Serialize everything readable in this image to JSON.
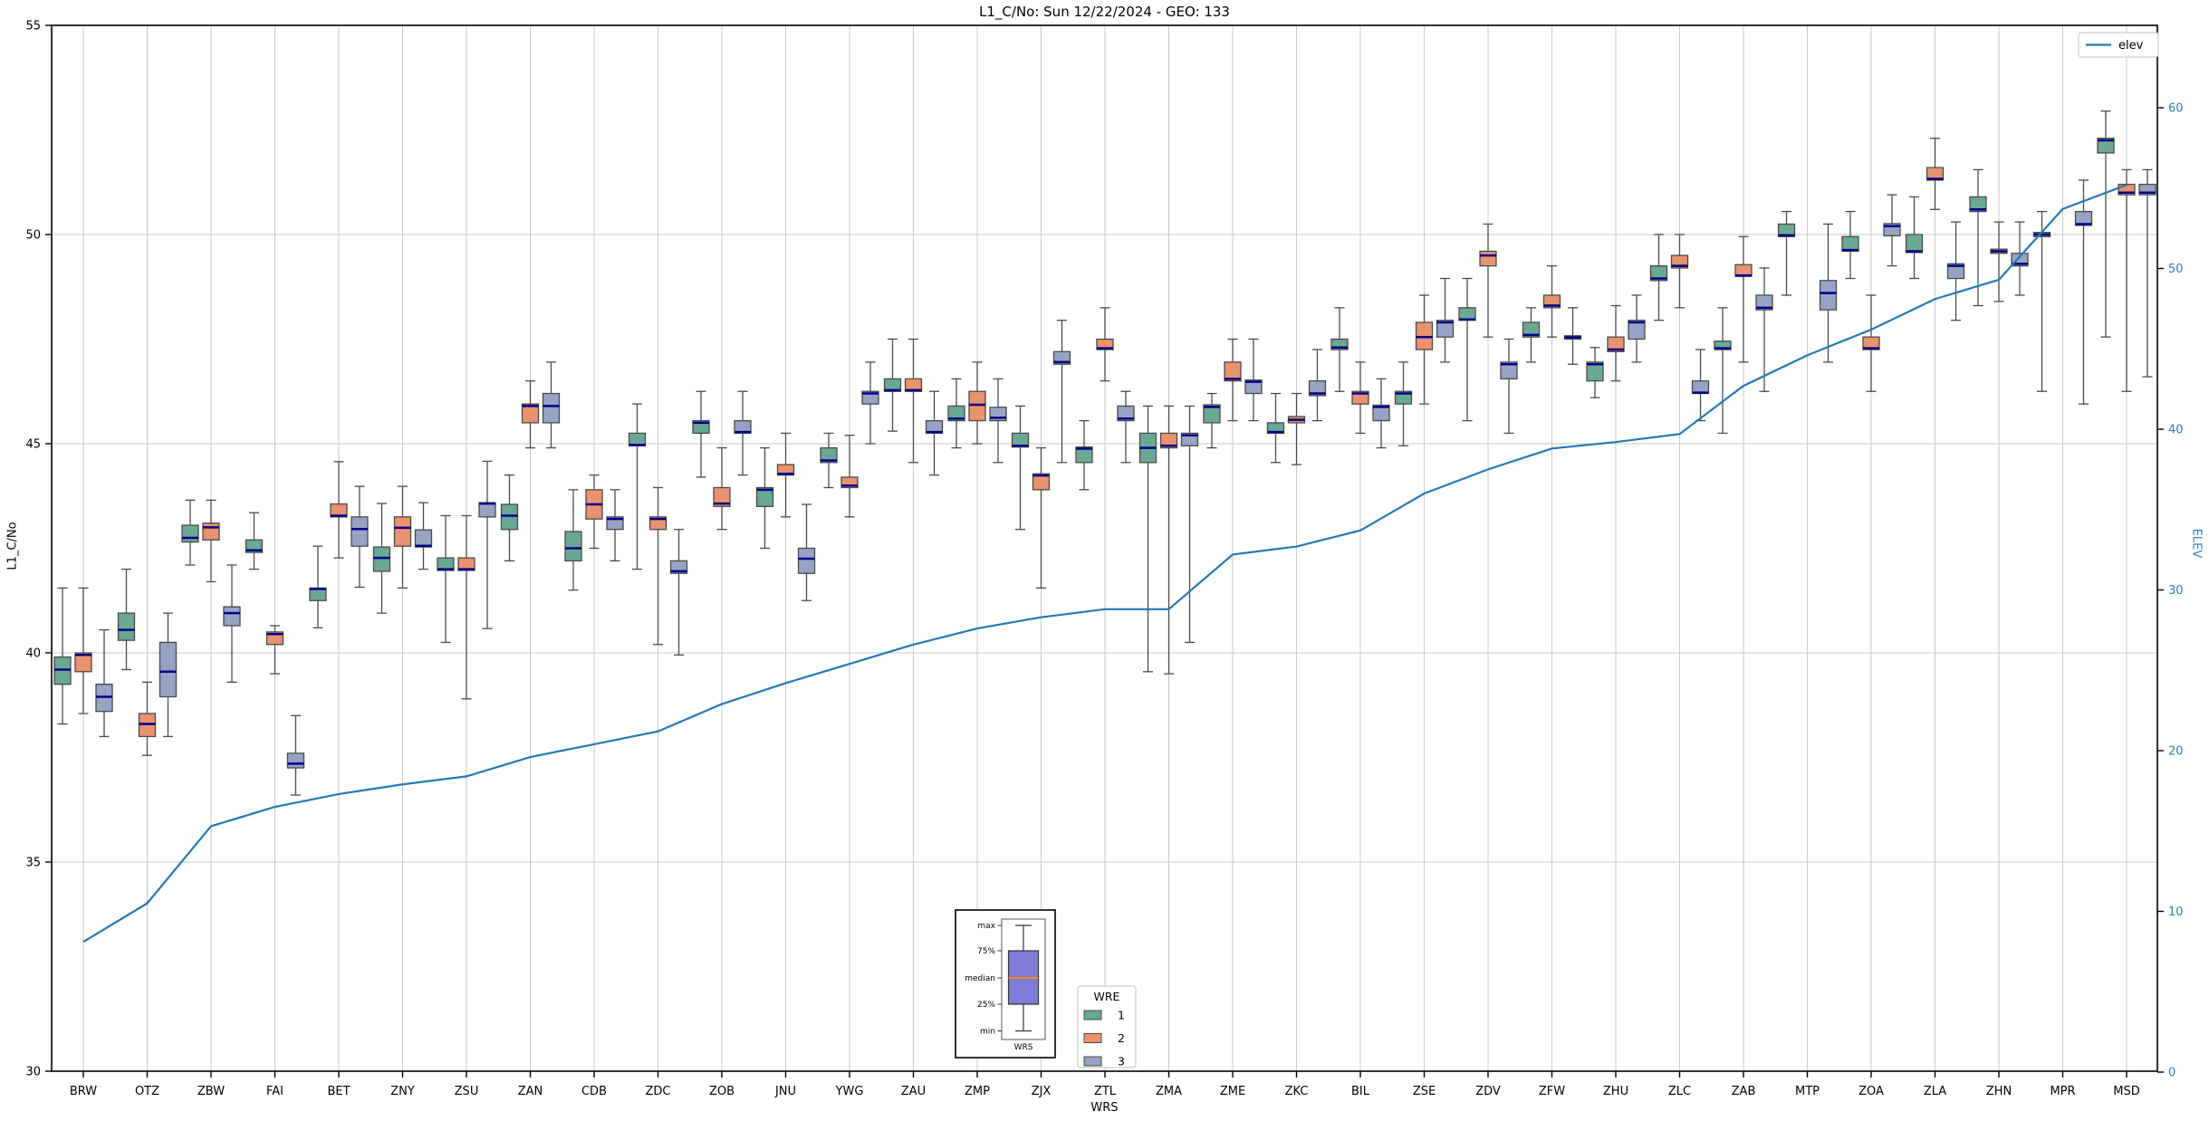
{
  "title": "L1_C/No: Sun 12/22/2024 - GEO: 133",
  "axes": {
    "xlabel": "WRS",
    "ylabel_left": "L1_C/No",
    "ylabel_right": "ELEV",
    "yticks_left": [
      55,
      50,
      45,
      40,
      35,
      30
    ],
    "yticks_right": [
      60,
      50,
      40,
      30,
      20,
      10,
      0
    ]
  },
  "legend_line": {
    "label": "elev"
  },
  "legend_wre": {
    "title": "WRE",
    "entries": [
      {
        "label": "1",
        "color": "#6aa893"
      },
      {
        "label": "2",
        "color": "#e9926f"
      },
      {
        "label": "3",
        "color": "#97a3c4"
      }
    ]
  },
  "inset": {
    "labels": [
      "max",
      "75%",
      "median",
      "25%",
      "min"
    ],
    "xlabel": "WRS"
  },
  "chart_data": {
    "type": "boxplot+line",
    "title": "L1_C/No: Sun 12/22/2024 - GEO: 133",
    "xlabel": "WRS",
    "ylabel_left": "L1_C/No",
    "ylabel_right": "ELEV",
    "ylim_left": [
      30,
      55
    ],
    "yticks_right": [
      0,
      10,
      20,
      30,
      40,
      50,
      60
    ],
    "grid": true,
    "legend_position_line": "top-right",
    "legend_position_wre": "bottom-center",
    "categories": [
      "BRW",
      "OTZ",
      "ZBW",
      "FAI",
      "BET",
      "ZNY",
      "ZSU",
      "ZAN",
      "CDB",
      "ZDC",
      "ZOB",
      "JNU",
      "YWG",
      "ZAU",
      "ZMP",
      "ZJX",
      "ZTL",
      "ZMA",
      "ZME",
      "ZKC",
      "BIL",
      "ZSE",
      "ZDV",
      "ZFW",
      "ZHU",
      "ZLC",
      "ZAB",
      "MTP",
      "ZOA",
      "ZLA",
      "ZHN",
      "MPR",
      "MSD"
    ],
    "box_format": [
      "whisker_low",
      "q1",
      "median",
      "q3",
      "whisker_high"
    ],
    "series": [
      {
        "name": "1",
        "color": "#6aa893",
        "boxes": [
          [
            38.3,
            39.25,
            39.6,
            39.9,
            41.55
          ],
          [
            39.6,
            40.3,
            40.55,
            40.95,
            42.0
          ],
          [
            42.1,
            42.65,
            42.75,
            43.05,
            43.65
          ],
          [
            42.0,
            42.4,
            42.45,
            42.7,
            43.35
          ],
          [
            40.6,
            41.25,
            41.53,
            41.55,
            42.55
          ],
          [
            40.95,
            41.95,
            42.27,
            42.53,
            43.57
          ],
          [
            40.25,
            41.97,
            42.0,
            42.27,
            43.28
          ],
          [
            42.2,
            42.95,
            43.28,
            43.55,
            44.25
          ],
          [
            41.5,
            42.2,
            42.5,
            42.9,
            43.9
          ],
          [
            42.0,
            44.95,
            44.97,
            45.25,
            45.95
          ],
          [
            44.2,
            45.25,
            45.5,
            45.55,
            46.25
          ],
          [
            42.5,
            43.5,
            43.9,
            43.95,
            44.9
          ],
          [
            43.95,
            44.55,
            44.6,
            44.9,
            45.25
          ],
          [
            45.3,
            46.25,
            46.28,
            46.55,
            47.5
          ],
          [
            44.9,
            45.55,
            45.6,
            45.9,
            46.55
          ],
          [
            42.95,
            44.92,
            44.95,
            45.25,
            45.9
          ],
          [
            43.9,
            44.55,
            44.88,
            44.92,
            45.55
          ],
          [
            39.55,
            44.55,
            44.9,
            45.25,
            45.9
          ],
          [
            44.9,
            45.5,
            45.88,
            45.93,
            46.2
          ],
          [
            44.55,
            45.25,
            45.28,
            45.5,
            46.2
          ],
          [
            46.25,
            47.25,
            47.3,
            47.5,
            48.25
          ],
          [
            44.95,
            45.95,
            46.2,
            46.25,
            46.95
          ],
          [
            45.55,
            47.95,
            47.97,
            48.25,
            48.95
          ],
          [
            46.95,
            47.55,
            47.6,
            47.9,
            48.25
          ],
          [
            46.1,
            46.5,
            46.9,
            46.95,
            47.3
          ],
          [
            47.95,
            48.9,
            48.95,
            49.25,
            50.0
          ],
          [
            45.25,
            47.25,
            47.28,
            47.45,
            48.25
          ],
          [
            48.55,
            49.95,
            49.98,
            50.25,
            50.55
          ],
          [
            48.95,
            49.6,
            49.63,
            49.95,
            50.55
          ],
          [
            48.95,
            49.57,
            49.6,
            50.0,
            50.9
          ],
          [
            48.3,
            50.55,
            50.6,
            50.9,
            51.55
          ],
          [
            46.25,
            49.95,
            50.0,
            50.05,
            50.55
          ],
          [
            47.55,
            51.95,
            52.25,
            52.3,
            52.95
          ]
        ]
      },
      {
        "name": "2",
        "color": "#e9926f",
        "boxes": [
          [
            38.55,
            39.55,
            39.95,
            40.0,
            41.55
          ],
          [
            37.55,
            38.0,
            38.3,
            38.55,
            39.3
          ],
          [
            41.7,
            42.7,
            43.0,
            43.1,
            43.65
          ],
          [
            39.5,
            40.2,
            40.45,
            40.5,
            40.65
          ],
          [
            42.27,
            43.25,
            43.28,
            43.56,
            44.57
          ],
          [
            41.55,
            42.55,
            42.99,
            43.25,
            43.98
          ],
          [
            38.9,
            41.97,
            42.0,
            42.27,
            43.28
          ],
          [
            44.9,
            45.5,
            45.9,
            45.95,
            46.5
          ],
          [
            42.5,
            43.2,
            43.55,
            43.9,
            44.25
          ],
          [
            40.2,
            42.95,
            43.2,
            43.25,
            43.95
          ],
          [
            42.95,
            43.5,
            43.57,
            43.95,
            44.9
          ],
          [
            43.25,
            44.25,
            44.28,
            44.5,
            45.25
          ],
          [
            43.25,
            43.95,
            44.0,
            44.2,
            45.2
          ],
          [
            44.55,
            46.25,
            46.28,
            46.55,
            47.5
          ],
          [
            45.0,
            45.55,
            45.93,
            46.25,
            46.95
          ],
          [
            41.55,
            43.9,
            44.24,
            44.28,
            44.9
          ],
          [
            46.5,
            47.25,
            47.28,
            47.5,
            48.25
          ],
          [
            39.5,
            44.9,
            44.95,
            45.25,
            45.9
          ],
          [
            45.55,
            46.5,
            46.55,
            46.95,
            47.5
          ],
          [
            44.5,
            45.5,
            45.57,
            45.65,
            46.2
          ],
          [
            45.25,
            45.95,
            46.2,
            46.25,
            46.95
          ],
          [
            45.95,
            47.25,
            47.55,
            47.9,
            48.55
          ],
          [
            47.55,
            49.25,
            49.5,
            49.6,
            50.25
          ],
          [
            47.55,
            48.25,
            48.3,
            48.55,
            49.25
          ],
          [
            46.5,
            47.2,
            47.25,
            47.55,
            48.3
          ],
          [
            48.25,
            49.2,
            49.25,
            49.5,
            50.0
          ],
          [
            46.95,
            49.0,
            49.02,
            49.28,
            49.95
          ],
          null,
          [
            46.25,
            47.25,
            47.28,
            47.55,
            48.55
          ],
          [
            50.6,
            51.3,
            51.33,
            51.6,
            52.3
          ],
          [
            48.4,
            49.55,
            49.6,
            49.65,
            50.3
          ],
          null,
          [
            46.25,
            50.95,
            51.0,
            51.2,
            51.55
          ]
        ]
      },
      {
        "name": "3",
        "color": "#97a3c4",
        "boxes": [
          [
            38.0,
            38.6,
            38.95,
            39.25,
            40.55
          ],
          [
            38.0,
            38.95,
            39.55,
            40.25,
            40.95
          ],
          [
            39.3,
            40.65,
            40.95,
            41.1,
            42.1
          ],
          [
            36.6,
            37.25,
            37.35,
            37.6,
            38.5
          ],
          [
            41.57,
            42.55,
            42.96,
            43.25,
            43.98
          ],
          [
            42.0,
            42.53,
            42.56,
            42.94,
            43.59
          ],
          [
            40.58,
            43.25,
            43.57,
            43.59,
            44.58
          ],
          [
            44.9,
            45.5,
            45.9,
            46.2,
            46.95
          ],
          [
            42.2,
            42.95,
            43.2,
            43.25,
            43.9
          ],
          [
            39.95,
            41.9,
            41.95,
            42.2,
            42.95
          ],
          [
            44.25,
            45.25,
            45.28,
            45.55,
            46.25
          ],
          [
            41.25,
            41.9,
            42.25,
            42.5,
            43.55
          ],
          [
            45.0,
            45.95,
            46.2,
            46.25,
            46.95
          ],
          [
            44.25,
            45.25,
            45.28,
            45.55,
            46.25
          ],
          [
            44.55,
            45.55,
            45.62,
            45.87,
            46.55
          ],
          [
            44.55,
            46.9,
            46.95,
            47.2,
            47.95
          ],
          [
            44.55,
            45.55,
            45.6,
            45.9,
            46.25
          ],
          [
            40.25,
            44.95,
            45.2,
            45.25,
            45.9
          ],
          [
            45.55,
            46.2,
            46.48,
            46.52,
            47.5
          ],
          [
            45.55,
            46.15,
            46.2,
            46.5,
            47.25
          ],
          [
            44.9,
            45.55,
            45.88,
            45.92,
            46.55
          ],
          [
            46.95,
            47.55,
            47.9,
            47.95,
            48.95
          ],
          [
            45.25,
            46.55,
            46.9,
            46.95,
            47.5
          ],
          [
            46.9,
            47.5,
            47.54,
            47.58,
            48.25
          ],
          [
            46.95,
            47.5,
            47.9,
            47.95,
            48.55
          ],
          [
            45.55,
            46.2,
            46.22,
            46.5,
            47.25
          ],
          [
            46.25,
            48.2,
            48.25,
            48.55,
            49.2
          ],
          [
            46.95,
            48.2,
            48.6,
            48.9,
            50.25
          ],
          [
            49.25,
            49.97,
            50.2,
            50.26,
            50.95
          ],
          [
            47.95,
            48.95,
            49.25,
            49.3,
            50.3
          ],
          [
            48.55,
            49.25,
            49.3,
            49.55,
            50.3
          ],
          [
            45.95,
            50.22,
            50.25,
            50.55,
            51.3
          ],
          [
            46.6,
            50.95,
            51.0,
            51.2,
            51.55
          ]
        ]
      }
    ],
    "line": {
      "name": "elev",
      "color": "#2479b5",
      "values": [
        8.1,
        10.5,
        15.3,
        16.5,
        17.3,
        17.9,
        18.4,
        19.6,
        20.4,
        21.2,
        22.9,
        24.2,
        25.4,
        26.6,
        27.6,
        28.3,
        28.8,
        28.8,
        32.2,
        32.7,
        33.7,
        36.0,
        37.5,
        38.8,
        39.2,
        39.7,
        42.7,
        44.6,
        46.2,
        48.1,
        49.3,
        53.7,
        55.2
      ]
    },
    "colors": {
      "median": "#00008b",
      "box_edge": "#4a4a4a",
      "grid": "#c8c8c8",
      "spine": "#000000",
      "right_axis_text": "#2e7eb8",
      "inset_box": "#7f7bd9",
      "inset_median": "#ff8c00"
    }
  }
}
